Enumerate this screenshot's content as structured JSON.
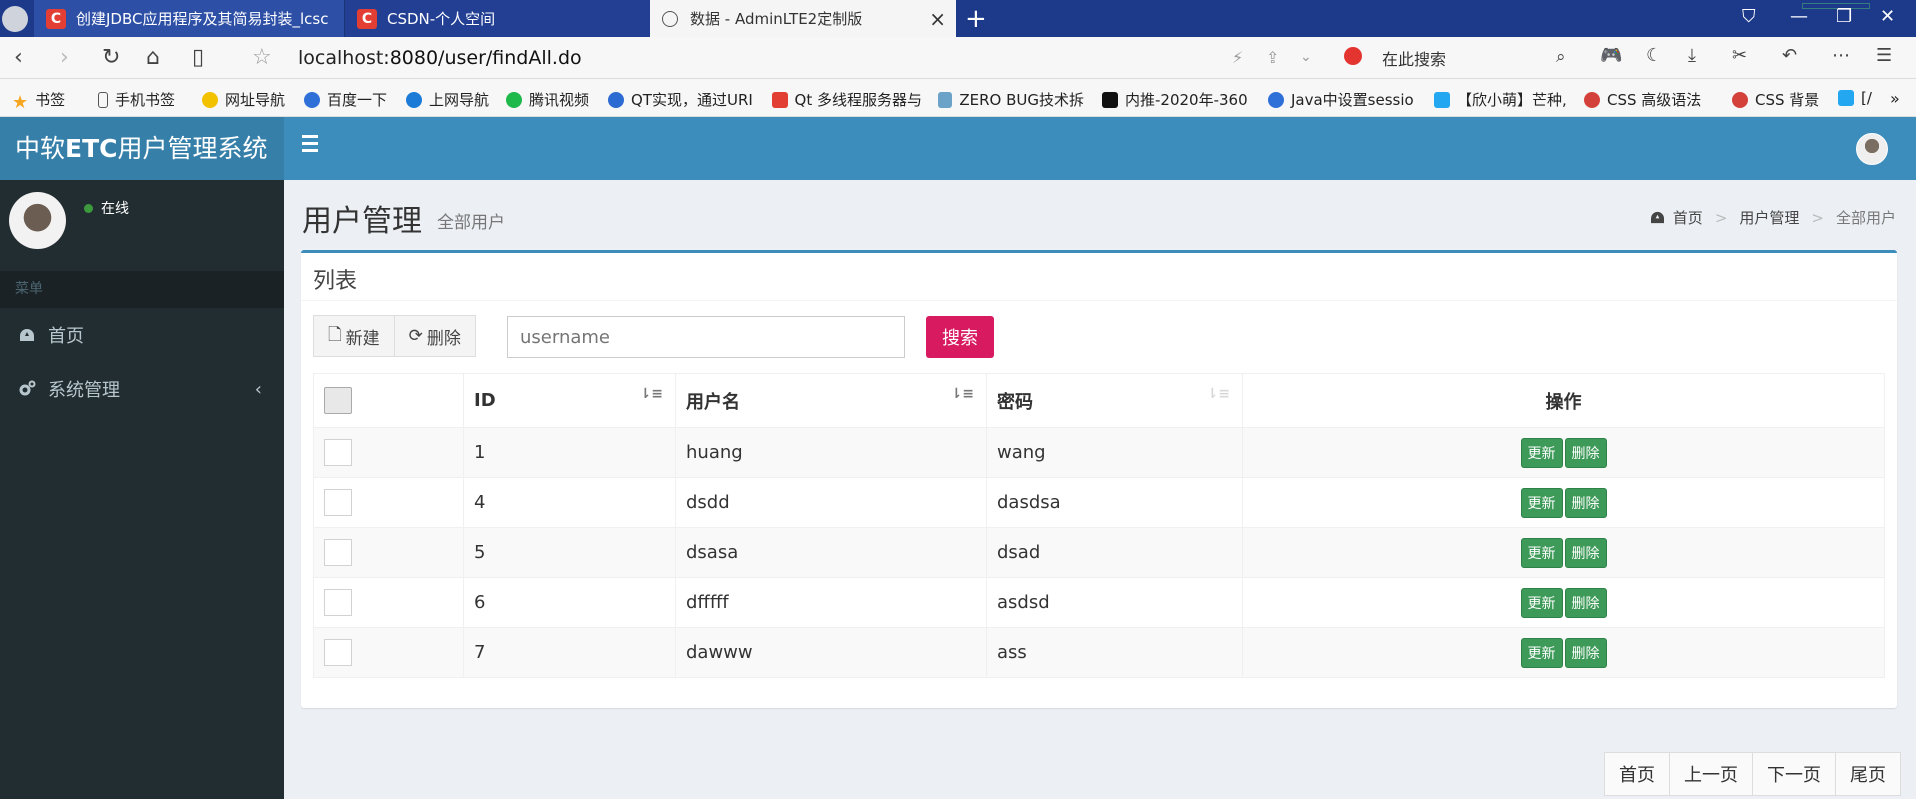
{
  "browser": {
    "tabs": [
      {
        "title": "创建JDBC应用程序及其简易封装_lcsc"
      },
      {
        "title": "CSDN-个人空间"
      },
      {
        "title": "数据 - AdminLTE2定制版"
      }
    ],
    "url_host": "localhost",
    "url_path": ":8080/user/findAll.do",
    "search_placeholder": "在此搜索",
    "bookmarks": [
      "书签",
      "手机书签",
      "网址导航",
      "百度一下",
      "上网导航",
      "腾讯视频",
      "QT实现，通过URI",
      "Qt 多线程服务器与",
      "ZERO BUG技术拆",
      "内推-2020年-360",
      "Java中设置sessio",
      "【欣小萌】芒种,",
      "CSS 高级语法",
      "CSS 背景",
      "[/"
    ]
  },
  "app": {
    "logo_prefix": "中软",
    "logo_bold": "ETC",
    "logo_suffix": "用户管理系统",
    "status": "在线",
    "menu_header": "菜单",
    "menu": [
      {
        "label": "首页"
      },
      {
        "label": "系统管理"
      }
    ]
  },
  "page": {
    "title": "用户管理",
    "subtitle": "全部用户",
    "breadcrumb": [
      "首页",
      "用户管理",
      "全部用户"
    ]
  },
  "list": {
    "title": "列表",
    "new_label": "新建",
    "delete_label": "删除",
    "search_placeholder": "username",
    "search_button": "搜索",
    "columns": [
      "ID",
      "用户名",
      "密码",
      "操作"
    ],
    "rows": [
      {
        "id": "1",
        "username": "huang",
        "password": "wang"
      },
      {
        "id": "4",
        "username": "dsdd",
        "password": "dasdsa"
      },
      {
        "id": "5",
        "username": "dsasa",
        "password": "dsad"
      },
      {
        "id": "6",
        "username": "dfffff",
        "password": "asdsd"
      },
      {
        "id": "7",
        "username": "dawww",
        "password": "ass"
      }
    ],
    "row_update": "更新",
    "row_delete": "删除"
  },
  "pager": {
    "first": "首页",
    "prev": "上一页",
    "next": "下一页",
    "last": "尾页"
  },
  "colors": {
    "header": "#3c8dbc",
    "logo": "#367fa9",
    "sidebar": "#222d32",
    "search_btn": "#d81b60",
    "row_btn": "#3d9a58"
  }
}
